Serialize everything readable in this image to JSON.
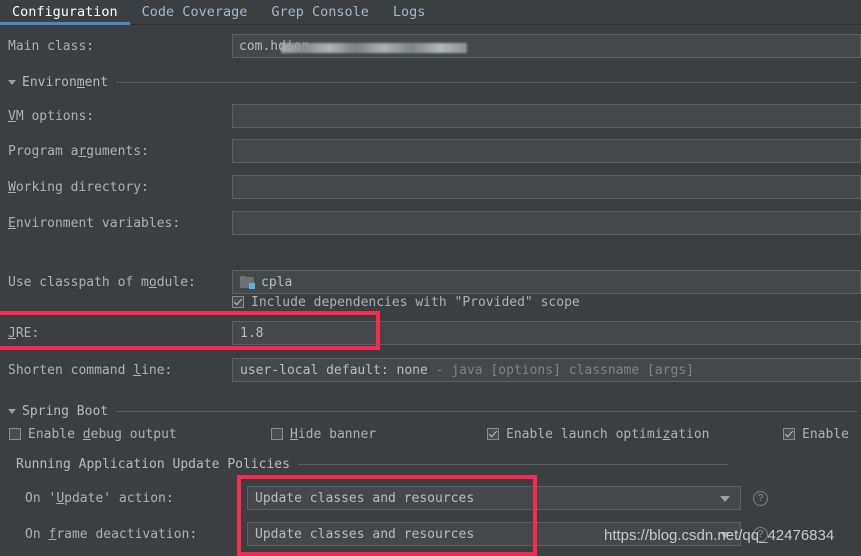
{
  "tabs": [
    {
      "label": "Configuration",
      "active": true
    },
    {
      "label": "Code Coverage",
      "active": false
    },
    {
      "label": "Grep Console",
      "active": false
    },
    {
      "label": "Logs",
      "active": false
    }
  ],
  "form": {
    "main_class": {
      "label": "Main class:",
      "mnemonic": "",
      "value": "com.hd",
      "value_suffix": "ion",
      "redacted": true
    },
    "environment_section": {
      "label": "Environment",
      "mnemonic": "m",
      "expanded": true
    },
    "vm_options": {
      "label_pre": "",
      "mnemonic": "V",
      "label_post": "M options:",
      "value": "",
      "placeholder": ""
    },
    "program_arguments": {
      "label_pre": "Program a",
      "mnemonic": "r",
      "label_post": "guments:",
      "value": "",
      "placeholder": ""
    },
    "working_directory": {
      "label_pre": "",
      "mnemonic": "W",
      "label_post": "orking directory:",
      "value": "",
      "placeholder": ""
    },
    "environment_variables": {
      "label_pre": "",
      "mnemonic": "E",
      "label_post": "nvironment variables:",
      "value": "",
      "placeholder": ""
    },
    "use_classpath_of_module": {
      "label_pre": "Use classpath of m",
      "mnemonic": "o",
      "label_post": "dule:",
      "value": "cpla",
      "icon": "module-icon"
    },
    "include_dependencies": {
      "label": "Include dependencies with \"Provided\" scope",
      "checked": true
    },
    "jre": {
      "label_pre": "",
      "mnemonic": "J",
      "label_post": "RE:",
      "value": "1.8"
    },
    "shorten_command_line": {
      "label_pre": "Shorten command ",
      "mnemonic": "l",
      "label_post": "ine:",
      "value": "user-local default: none",
      "value_hint": "- java [options] classname [args]"
    }
  },
  "spring_boot": {
    "section_label": "Spring Boot",
    "expanded": true,
    "enable_debug_output": {
      "label_pre": "Enable ",
      "mnemonic": "d",
      "label_post": "ebug output",
      "checked": false
    },
    "hide_banner": {
      "label_pre": "",
      "mnemonic": "H",
      "label_post": "ide banner",
      "checked": false
    },
    "enable_launch_optimization": {
      "label_pre": "Enable launch optimi",
      "mnemonic": "z",
      "label_post": "ation",
      "checked": true
    },
    "enable_partial": {
      "label": "Enable",
      "checked": true
    },
    "update_policies": {
      "section_label": "Running Application Update Policies",
      "on_update_action": {
        "label_pre": "On '",
        "mnemonic": "U",
        "label_post": "pdate' action:",
        "value": "Update classes and resources",
        "help": "help-icon"
      },
      "on_frame_deactivation": {
        "label_pre": "On ",
        "mnemonic": "f",
        "label_post": "rame deactivation:",
        "value": "Update classes and resources",
        "help": "help-icon"
      }
    }
  },
  "annotations": {
    "color": "#f9294f",
    "boxes": [
      "jre-row-highlight",
      "update-policies-highlight"
    ]
  },
  "watermark": {
    "text": "https://blog.csdn.net/qq_42476834"
  },
  "colors": {
    "background": "#3c3f41",
    "field_background": "#45484a",
    "accent_tab": "#4a88c7",
    "annotation_red": "#f9294f",
    "module_icon_accent": "#56b6d8"
  }
}
